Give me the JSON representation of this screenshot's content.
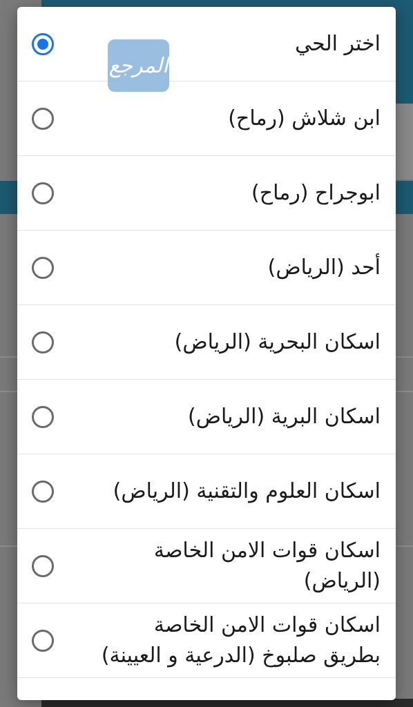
{
  "dialog": {
    "selected_index": 0,
    "options": [
      {
        "label": "اختر الحي"
      },
      {
        "label": "ابن شلاش (رماح)"
      },
      {
        "label": "ابوجراح (رماح)"
      },
      {
        "label": "أحد (الرياض)"
      },
      {
        "label": "اسكان البحرية (الرياض)"
      },
      {
        "label": "اسكان البرية (الرياض)"
      },
      {
        "label": "اسكان العلوم والتقنية (الرياض)"
      },
      {
        "label": "اسكان قوات الامن الخاصة (الرياض)"
      },
      {
        "label": "اسكان قوات الامن الخاصة بطريق صلبوخ (الدرعية و العيينة)"
      }
    ]
  },
  "watermark": {
    "text": "المرجع"
  },
  "colors": {
    "accent": "#1a73e8",
    "radio_unchecked": "#6a6a6a"
  }
}
